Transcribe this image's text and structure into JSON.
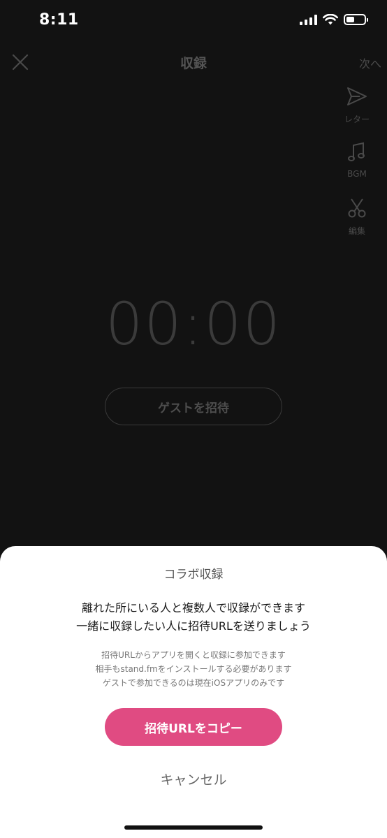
{
  "status_bar": {
    "time": "8:11",
    "battery_level": 0.45
  },
  "header": {
    "close_icon": "close-icon",
    "title": "収録",
    "next_label": "次へ"
  },
  "side_tools": [
    {
      "icon": "paper-plane-icon",
      "label": "レター"
    },
    {
      "icon": "music-note-icon",
      "label": "BGM"
    },
    {
      "icon": "scissors-icon",
      "label": "編集"
    }
  ],
  "recorder": {
    "timer": "00:00",
    "invite_guest_label": "ゲストを招待"
  },
  "sheet": {
    "title": "コラボ収録",
    "main_line1": "離れた所にいる人と複数人で収録ができます",
    "main_line2": "一緒に収録したい人に招待URLを送りましょう",
    "sub_line1": "招待URLからアプリを開くと収録に参加できます",
    "sub_line2": "相手もstand.fmをインストールする必要があります",
    "sub_line3": "ゲストで参加できるのは現在iOSアプリのみです",
    "copy_button": "招待URLをコピー",
    "cancel_button": "キャンセル"
  },
  "colors": {
    "background": "#121212",
    "accent": "#e04b82",
    "sheet": "#ffffff"
  }
}
